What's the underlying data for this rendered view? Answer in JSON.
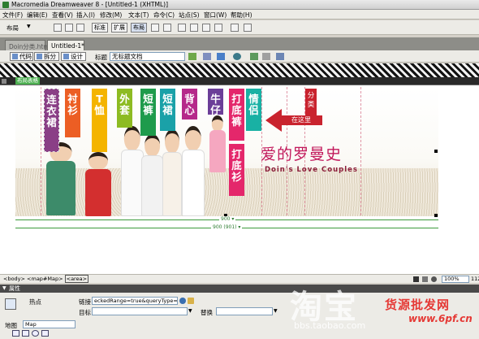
{
  "window": {
    "title": "Macromedia Dreamweaver 8 - [Untitled-1 (XHTML)]"
  },
  "menu": [
    "文件(F)",
    "编辑(E)",
    "查看(V)",
    "插入(I)",
    "修改(M)",
    "文本(T)",
    "命令(C)",
    "站点(S)",
    "窗口(W)",
    "帮助(H)"
  ],
  "insert_toolbar": {
    "category": "布局",
    "buttons": [
      "标准",
      "扩展",
      "布局"
    ]
  },
  "doc_tabs": [
    "Doin分类.html",
    "Untitled-1*"
  ],
  "doc_toolbar": {
    "views": [
      "代码",
      "拆分",
      "设计"
    ],
    "title_label": "标题",
    "title_value": "无标题文档"
  },
  "table_mode": {
    "label": "布局表格"
  },
  "banner": {
    "category_bars": [
      {
        "text": "连衣裙",
        "color": "#8a3f86"
      },
      {
        "text": "衬衫",
        "color": "#ec5e24"
      },
      {
        "text": "T恤",
        "color": "#f4b400"
      },
      {
        "text": "外套",
        "color": "#8dbb22"
      },
      {
        "text": "短裤",
        "color": "#1e9b4c"
      },
      {
        "text": "短裙",
        "color": "#1aa1a8"
      },
      {
        "text": "背心",
        "color": "#b5298a"
      },
      {
        "text": "牛仔",
        "color": "#6b3e98"
      },
      {
        "text": "打底裤",
        "color": "#e4276b"
      },
      {
        "text": "情侣",
        "color": "#19b1a4"
      }
    ],
    "extra_bar": {
      "text": "打底衫",
      "color": "#e4276b"
    },
    "arrow_label": "在这里",
    "category_tag": "分类",
    "brand_cn": "爱的罗曼史",
    "brand_en": "Doin's Love Couples"
  },
  "width_labels": {
    "inner": "900 ▾",
    "outer": "900 (901) ▾"
  },
  "status": {
    "tags": [
      "<body>",
      "<map#Map>",
      "<area>"
    ],
    "zoom": "100%",
    "size": "112"
  },
  "properties": {
    "header": "属性",
    "hotspot_label": "热点",
    "link_label": "链接",
    "link_value": "eckedRange=true&queryType=cat",
    "target_label": "目标",
    "alt_label": "替换",
    "map_label": "地图",
    "map_value": "Map"
  },
  "watermark": {
    "tao": "淘宝",
    "url": "bbs.taobao.com",
    "cn": "货源批发网",
    "site": "www.6pf.cn"
  }
}
